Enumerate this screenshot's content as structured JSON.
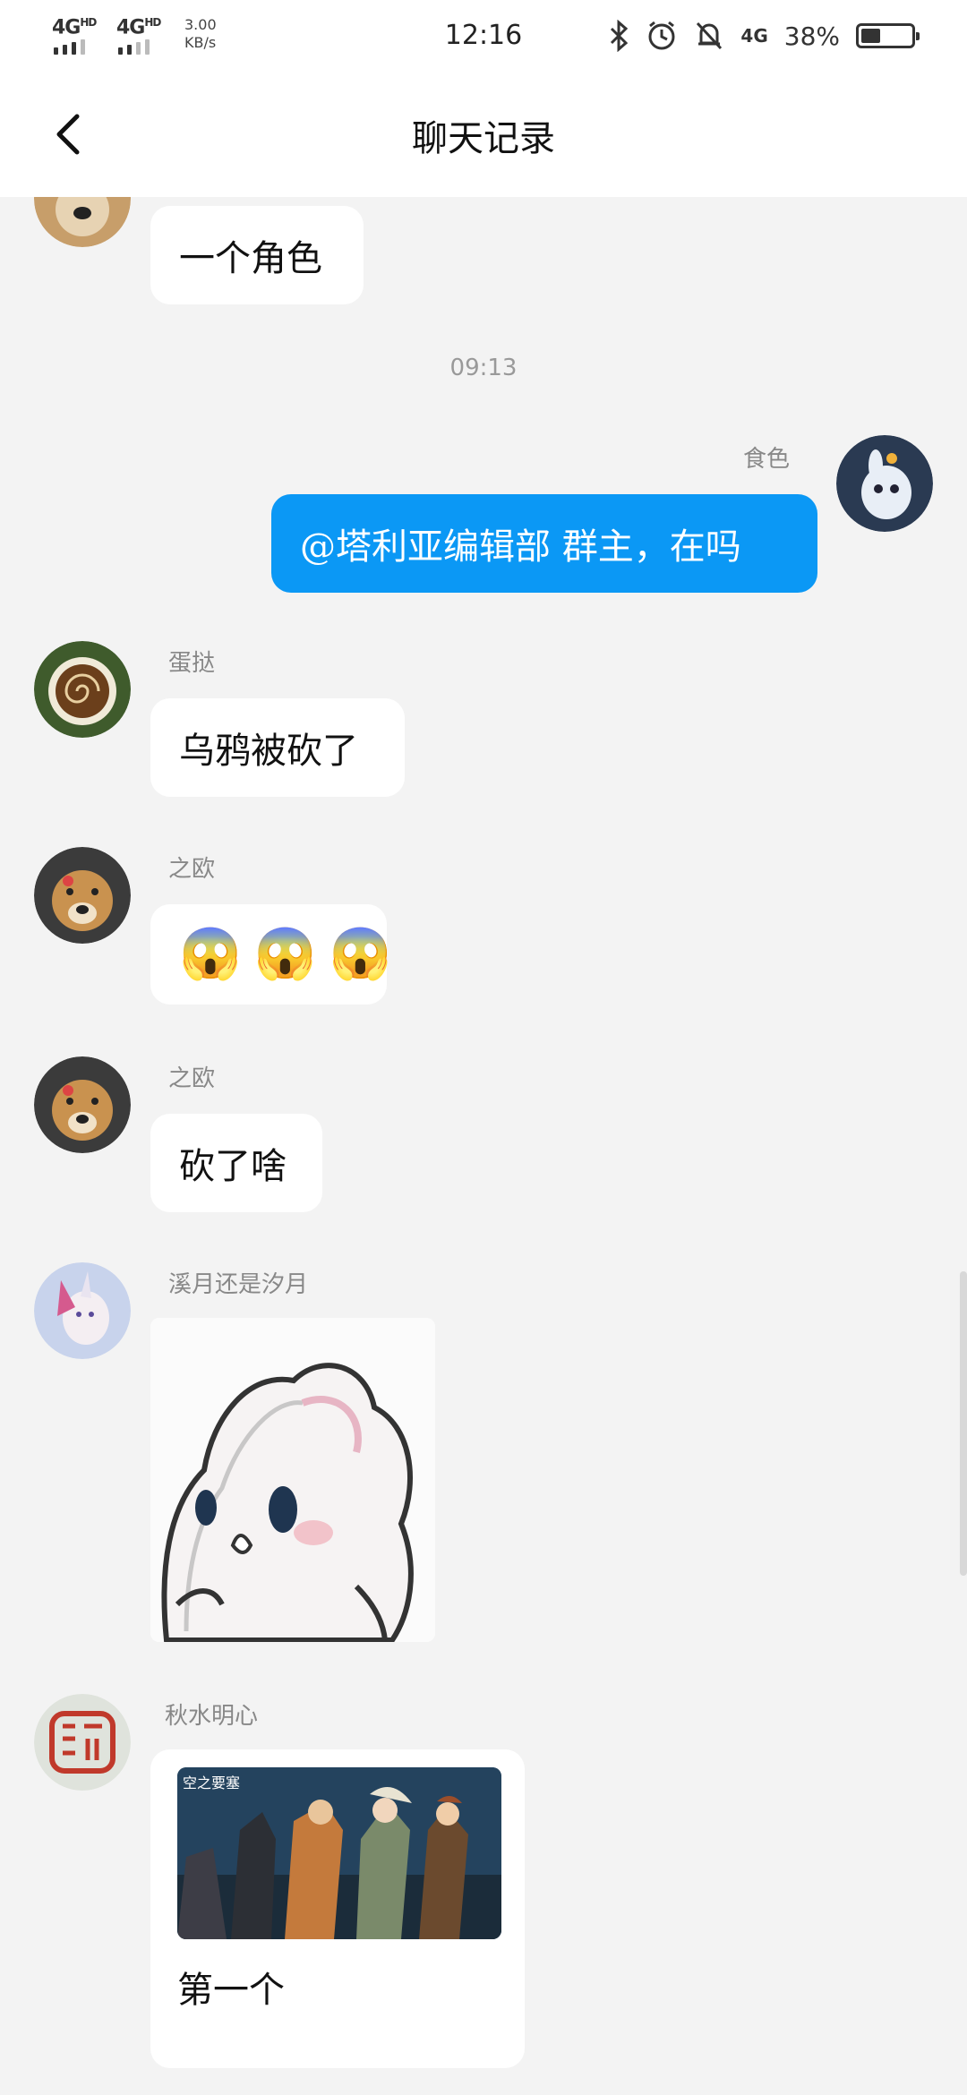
{
  "status_bar": {
    "network1": "4G",
    "network1_sup": "HD",
    "network2": "4G",
    "network2_sup": "HD",
    "speed_value": "3.00",
    "speed_unit": "KB/s",
    "time": "12:16",
    "mobile_data": "4G",
    "battery_percent": "38%",
    "battery_level": 0.38
  },
  "header": {
    "title": "聊天记录"
  },
  "chat": {
    "messages": [
      {
        "sender": "",
        "text": "一个角色"
      },
      {
        "timestamp": "09:13"
      },
      {
        "sender": "食色",
        "text": "@塔利亚编辑部 群主，在吗"
      },
      {
        "sender": "蛋挞",
        "text": "乌鸦被砍了"
      },
      {
        "sender": "之欧",
        "emojis": [
          "😱",
          "😱",
          "😱"
        ]
      },
      {
        "sender": "之欧",
        "text": "砍了啥"
      },
      {
        "sender": "溪月还是汐月",
        "sticker": "bunny-sticker"
      },
      {
        "sender": "秋水明心",
        "image_caption_logo": "空之要塞",
        "text": "第一个"
      }
    ]
  }
}
